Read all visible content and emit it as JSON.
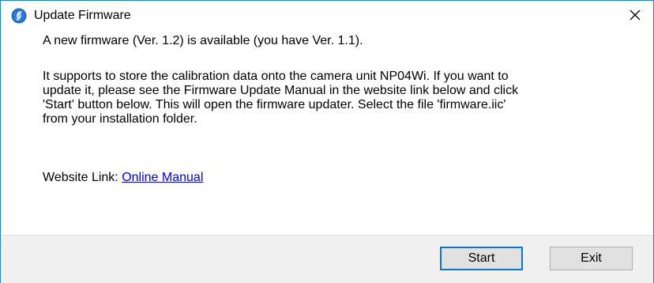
{
  "window": {
    "title": "Update Firmware",
    "app_icon": "swirl-app-icon",
    "close_icon": "close-icon",
    "accent": "#1883d7"
  },
  "message": {
    "line1": "A new firmware (Ver. 1.2) is available (you have Ver. 1.1).",
    "paragraph_lines": [
      "It supports to store the calibration data onto the camera unit NP04Wi. If you want to",
      "update it, please see the Firmware Update Manual in the website link below and click",
      "'Start' button below. This will open the firmware updater. Select the file 'firmware.iic'",
      "from your installation folder."
    ],
    "link_label": "Website Link:",
    "link_text": "Online Manual",
    "link_color": "#0000ee"
  },
  "buttons": {
    "start_label": "Start",
    "exit_label": "Exit"
  }
}
